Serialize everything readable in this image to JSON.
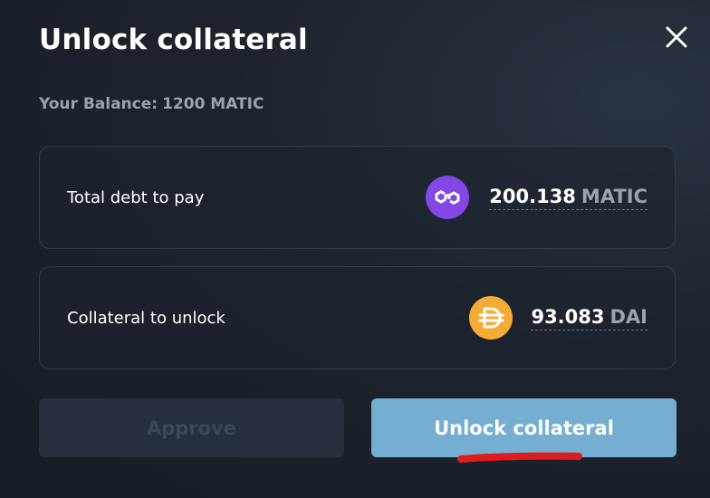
{
  "modal": {
    "title": "Unlock collateral",
    "close_icon": "close-icon"
  },
  "balance": {
    "label": "Your Balance:",
    "value": "1200 MATIC"
  },
  "debt": {
    "label": "Total debt to pay",
    "amount": "200.138",
    "unit": "MATIC",
    "icon": "matic-token-icon",
    "icon_color": "#8247e5"
  },
  "collateral": {
    "label": "Collateral to unlock",
    "amount": "93.083",
    "unit": "DAI",
    "icon": "dai-token-icon",
    "icon_color": "#f5ac37"
  },
  "buttons": {
    "approve_label": "Approve",
    "approve_disabled": true,
    "unlock_label": "Unlock collateral"
  },
  "colors": {
    "accent_button": "#74aed0",
    "annotation_red": "#e01b1b"
  }
}
